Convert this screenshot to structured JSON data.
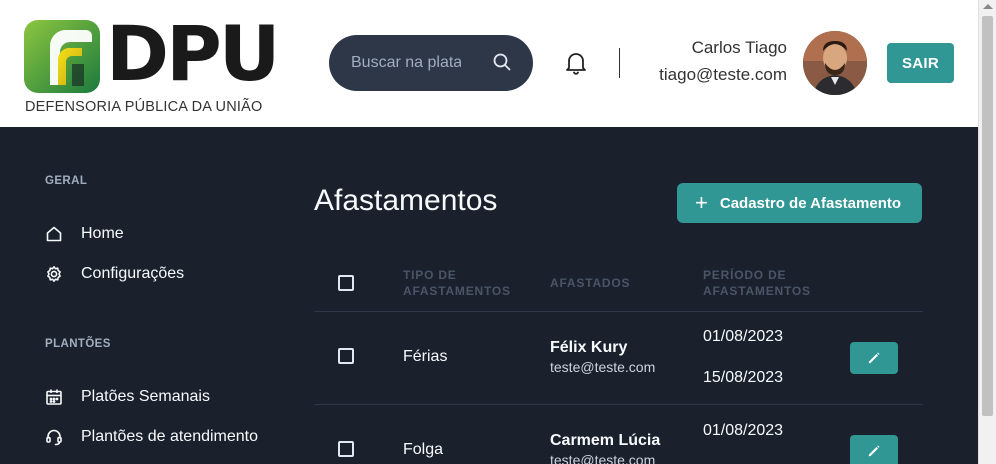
{
  "header": {
    "logo_text": "DPU",
    "logo_subtitle": "DEFENSORIA PÚBLICA DA UNIÃO",
    "search_placeholder": "Buscar na plataforma",
    "user_name": "Carlos Tiago",
    "user_email": "tiago@teste.com",
    "logout_label": "SAIR"
  },
  "sidebar": {
    "sections": [
      {
        "title": "GERAL",
        "items": [
          {
            "label": "Home",
            "icon": "home-icon"
          },
          {
            "label": "Configurações",
            "icon": "settings-icon"
          }
        ]
      },
      {
        "title": "PLANTÕES",
        "items": [
          {
            "label": "Platões Semanais",
            "icon": "calendar-icon"
          },
          {
            "label": "Plantões de atendimento",
            "icon": "headset-icon"
          }
        ]
      }
    ]
  },
  "main": {
    "title": "Afastamentos",
    "add_button_label": "Cadastro de Afastamento",
    "table": {
      "headers": {
        "type_line1": "TIPO DE",
        "type_line2": "AFASTAMENTOS",
        "people": "AFASTADOS",
        "period_line1": "PERÍODO DE",
        "period_line2": "AFASTAMENTOS"
      },
      "rows": [
        {
          "type": "Férias",
          "name": "Félix Kury",
          "email": "teste@teste.com",
          "start": "01/08/2023",
          "end": "15/08/2023"
        },
        {
          "type": "Folga",
          "name": "Carmem Lúcia",
          "email": "teste@teste.com",
          "start": "01/08/2023",
          "end": ""
        }
      ]
    }
  },
  "colors": {
    "accent": "#319795",
    "background": "#1a202c",
    "header_bg": "#ffffff",
    "search_bg": "#2d3748"
  }
}
